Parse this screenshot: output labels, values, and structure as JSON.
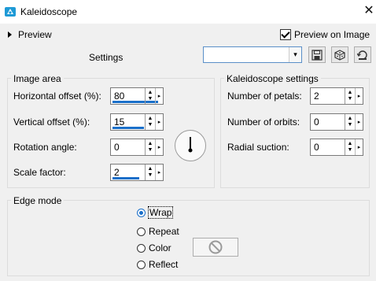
{
  "window": {
    "title": "Kaleidoscope",
    "close_glyph": "✕"
  },
  "preview_toggle": {
    "label": "Preview"
  },
  "preview_on_image": {
    "label": "Preview on Image",
    "checked": true
  },
  "settings": {
    "label": "Settings",
    "value": ""
  },
  "image_area": {
    "title": "Image area",
    "horizontal_offset": {
      "label": "Horizontal offset (%):",
      "value": "80"
    },
    "vertical_offset": {
      "label": "Vertical offset (%):",
      "value": "15"
    },
    "rotation_angle": {
      "label": "Rotation angle:",
      "value": "0"
    },
    "scale_factor": {
      "label": "Scale factor:",
      "value": "2"
    }
  },
  "kaleidoscope_settings": {
    "title": "Kaleidoscope settings",
    "petals": {
      "label": "Number of petals:",
      "value": "2"
    },
    "orbits": {
      "label": "Number of orbits:",
      "value": "0"
    },
    "suction": {
      "label": "Radial suction:",
      "value": "0"
    }
  },
  "edge_mode": {
    "title": "Edge mode",
    "options": [
      {
        "label": "Wrap",
        "selected": true
      },
      {
        "label": "Repeat",
        "selected": false
      },
      {
        "label": "Color",
        "selected": false
      },
      {
        "label": "Reflect",
        "selected": false
      }
    ]
  },
  "colors": {
    "accent": "#1a6fc9",
    "app_icon": "#1e9ad6"
  }
}
